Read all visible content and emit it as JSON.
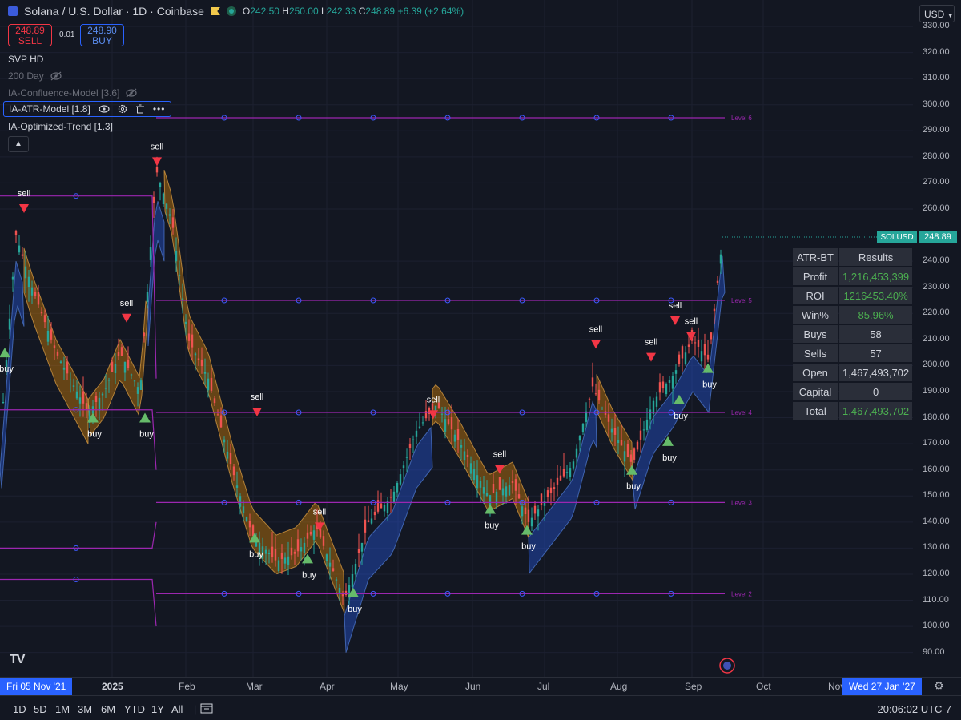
{
  "header": {
    "title": "Solana / U.S. Dollar · 1D · Coinbase",
    "o_label": "O",
    "o_value": "242.50",
    "h_label": "H",
    "h_value": "250.00",
    "l_label": "L",
    "l_value": "242.33",
    "c_label": "C",
    "c_value": "248.89",
    "change": "+6.39 (+2.64%)"
  },
  "trade": {
    "sell_price": "248.89",
    "sell_label": "SELL",
    "spread": "0.01",
    "buy_price": "248.90",
    "buy_label": "BUY"
  },
  "indicators": [
    {
      "name": "SVP HD"
    },
    {
      "name": "200 Day"
    },
    {
      "name": "IA-Confluence-Model [3.6]"
    },
    {
      "name": "IA-ATR-Model [1.8]"
    },
    {
      "name": "IA-Optimized-Trend [1.3]"
    }
  ],
  "currency": "USD",
  "symbol_label": "SOLUSD",
  "last_price": "248.89",
  "price_ticks": [
    "330.00",
    "320.00",
    "310.00",
    "300.00",
    "290.00",
    "280.00",
    "270.00",
    "260.00",
    "240.00",
    "230.00",
    "220.00",
    "210.00",
    "200.00",
    "190.00",
    "180.00",
    "170.00",
    "160.00",
    "150.00",
    "140.00",
    "130.00",
    "120.00",
    "110.00",
    "100.00",
    "90.00"
  ],
  "time_labels": [
    "2025",
    "Feb",
    "Mar",
    "Apr",
    "May",
    "Jun",
    "Jul",
    "Aug",
    "Sep",
    "Oct",
    "Nov"
  ],
  "cursor_date_left": "Fri 05 Nov '21",
  "cursor_date_right": "Wed 27 Jan '27",
  "ranges": [
    "1D",
    "5D",
    "1M",
    "3M",
    "6M",
    "YTD",
    "1Y",
    "All"
  ],
  "clock": "20:06:02 UTC-7",
  "logo_text": "TV",
  "backtest": {
    "header_key": "ATR-BT",
    "header_val": "Results",
    "rows": [
      {
        "k": "Profit",
        "v": "1,216,453,399",
        "green": true
      },
      {
        "k": "ROI",
        "v": "1216453.40%",
        "green": true
      },
      {
        "k": "Win%",
        "v": "85.96%",
        "green": true
      },
      {
        "k": "Buys",
        "v": "58",
        "green": false
      },
      {
        "k": "Sells",
        "v": "57",
        "green": false
      },
      {
        "k": "Open",
        "v": "1,467,493,702",
        "green": false
      },
      {
        "k": "Capital",
        "v": "0",
        "green": false
      },
      {
        "k": "Total",
        "v": "1,467,493,702",
        "green": true
      }
    ]
  },
  "levels": [
    {
      "label": "Level 6",
      "price": 295
    },
    {
      "label": "Level 5",
      "price": 225
    },
    {
      "label": "Level 4",
      "price": 182
    },
    {
      "label": "Level 3",
      "price": 147.5
    },
    {
      "label": "Level 2",
      "price": 112.5
    }
  ],
  "signal_texts": {
    "sell": "sell",
    "buy": "buy"
  },
  "colors": {
    "up": "#26a69a",
    "down": "#ef5350",
    "level": "#9c27b0",
    "bull_band": "#2962ff",
    "bear_band": "#ff9800",
    "accent": "#2962ff"
  }
}
